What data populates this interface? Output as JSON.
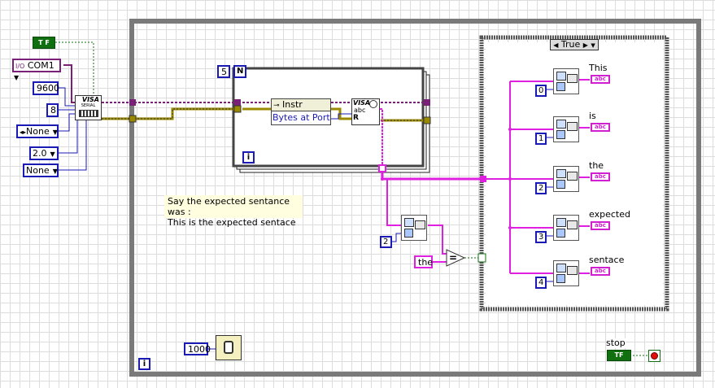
{
  "controls": {
    "bool_const": "T F",
    "visa_resource": "COM1",
    "baud_rate": "9600",
    "data_bits": "8",
    "parity": "None",
    "stop_bits": "2.0",
    "flow_control": "None"
  },
  "serial_icon": {
    "line1": "VISA",
    "line2": "SERIAL"
  },
  "for_loop": {
    "count": "5",
    "count_terminal": "N",
    "iteration_terminal": "i"
  },
  "property_node": {
    "class": "Instr",
    "property": "Bytes at Port"
  },
  "visa_read": {
    "line1": "VISA",
    "line2": "abc",
    "line3": "R"
  },
  "comment": {
    "line1": "Say the expected sentance was :",
    "line2": "This is the expected sentace"
  },
  "compare": {
    "index": "2",
    "string": "the",
    "operator": "="
  },
  "case_structure": {
    "selector": "True",
    "rows": [
      {
        "index": "0",
        "label": "This"
      },
      {
        "index": "1",
        "label": "is"
      },
      {
        "index": "2",
        "label": "the"
      },
      {
        "index": "3",
        "label": "expected"
      },
      {
        "index": "4",
        "label": "sentace"
      }
    ],
    "indicator_text": "abc"
  },
  "while_loop": {
    "iteration_terminal": "i",
    "wait_ms": "1000",
    "stop_label": "stop",
    "stop_const": "TF"
  },
  "colors": {
    "loop_border": "#7a7a7a",
    "numeric_blue": "#1a1ab4",
    "string_pink": "#e020e0",
    "error_cluster": "#9a8a00",
    "visa_purple": "#7a2078",
    "boolean_green": "#107010"
  }
}
